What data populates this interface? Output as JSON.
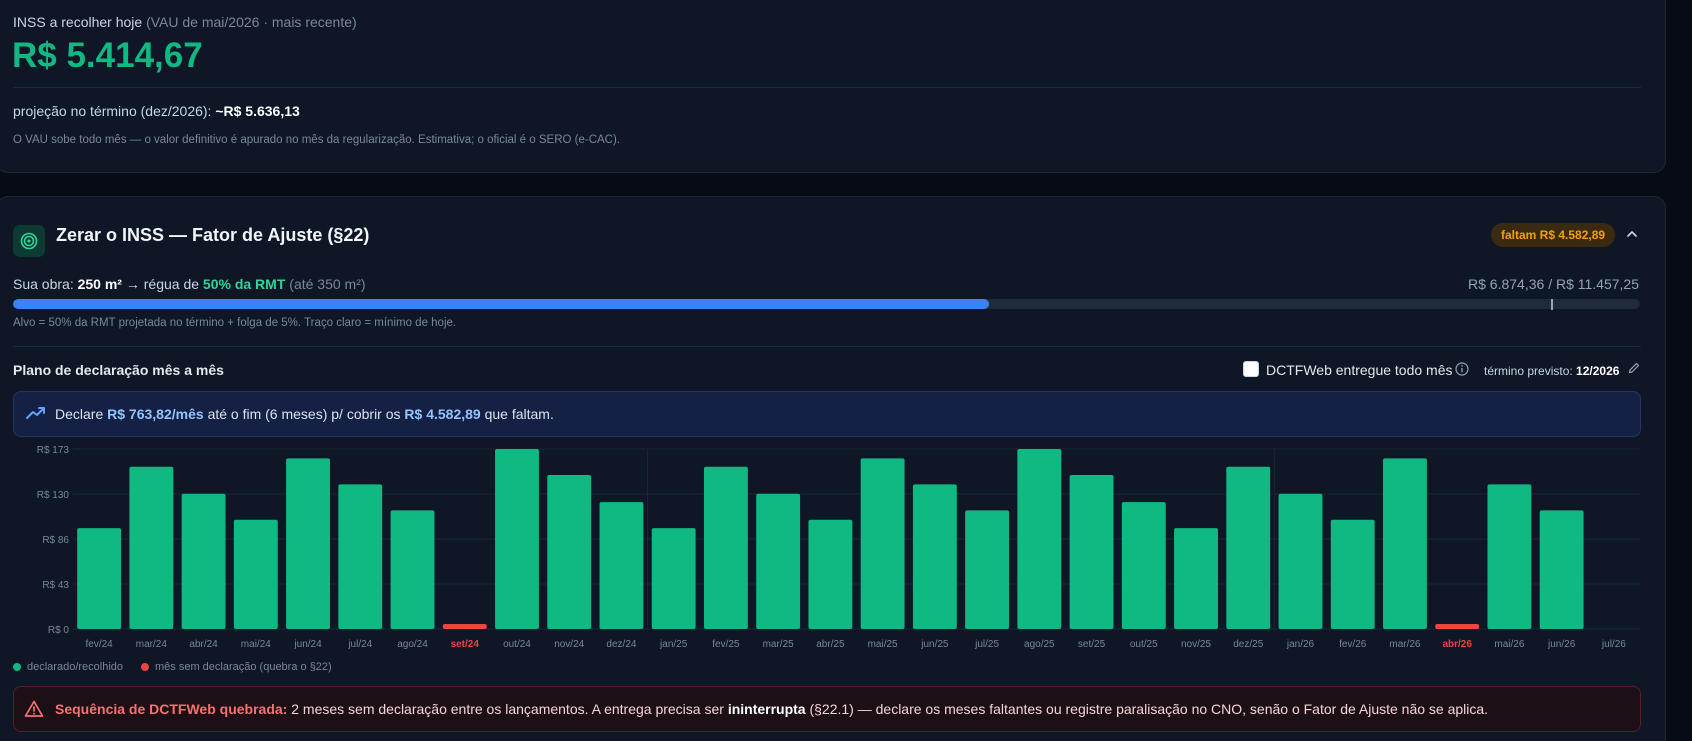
{
  "summary": {
    "label": "INSS a recolher hoje",
    "label_note": "(VAU de mai/2026 · mais recente)",
    "amount": "R$ 5.414,67",
    "projection_label": "projeção no término (dez/2026):",
    "projection_value": "~R$ 5.636,13",
    "footnote": "O VAU sobe todo mês — o valor definitivo é apurado no mês da regularização. Estimativa; o oficial é o SERO (e-CAC)."
  },
  "fator": {
    "title": "Zerar o INSS — Fator de Ajuste (§22)",
    "icon": "target-icon",
    "badge": "faltam R$ 4.582,89",
    "obra_prefix": "Sua obra:",
    "obra_area": "250 m²",
    "obra_mid": "→ régua de",
    "obra_regua": "50% da RMT",
    "obra_limit": "(até 350 m²)",
    "progress_text": "R$ 6.874,36 / R$ 11.457,25",
    "progress_fraction": 0.6,
    "minimum_fraction": 0.9456,
    "alvo_note": "Alvo = 50% da RMT projetada no término + folga de 5%. Traço claro = mínimo de hoje."
  },
  "plano": {
    "title": "Plano de declaração mês a mês",
    "checkbox_label": "DCTFWeb entregue todo mês",
    "termino_label": "término previsto:",
    "termino_value": "12/2026",
    "banner_prefix": "Declare",
    "banner_amount": "R$ 763,82/mês",
    "banner_mid": "até o fim (6 meses) p/ cobrir os",
    "banner_total": "R$ 4.582,89",
    "banner_suffix": "que faltam."
  },
  "chart_data": {
    "type": "bar",
    "categories": [
      "fev/24",
      "mar/24",
      "abr/24",
      "mai/24",
      "jun/24",
      "jul/24",
      "ago/24",
      "set/24",
      "out/24",
      "nov/24",
      "dez/24",
      "jan/25",
      "fev/25",
      "mar/25",
      "abr/25",
      "mai/25",
      "jun/25",
      "jul/25",
      "ago/25",
      "set/25",
      "out/25",
      "nov/25",
      "dez/25",
      "jan/26",
      "fev/26",
      "mar/26",
      "abr/26",
      "mai/26",
      "jun/26",
      "jul/26"
    ],
    "values": [
      97,
      156,
      130,
      105,
      164,
      139,
      114,
      0,
      173,
      148,
      122,
      97,
      156,
      130,
      105,
      164,
      139,
      114,
      173,
      148,
      122,
      97,
      156,
      130,
      105,
      164,
      0,
      139,
      114,
      null
    ],
    "missing": [
      "set/24",
      "abr/26"
    ],
    "yticks": [
      "R$ 0",
      "R$ 43",
      "R$ 86",
      "R$ 130",
      "R$ 173"
    ],
    "ylim": [
      0,
      173
    ],
    "grid": true,
    "colors": {
      "declared": "#10b981",
      "missing": "#ef4444"
    },
    "legend": [
      {
        "label": "declarado/recolhido",
        "color": "#10b981"
      },
      {
        "label": "mês sem declaração (quebra o §22)",
        "color": "#ef4444"
      }
    ]
  },
  "alert": {
    "strong": "Sequência de DCTFWeb quebrada:",
    "text1": "2 meses sem declaração entre os lançamentos. A entrega precisa ser",
    "strong2": "ininterrupta",
    "text2": "(§22.1) — declare os meses faltantes ou registre paralisação no CNO, senão o Fator de Ajuste não se aplica."
  }
}
